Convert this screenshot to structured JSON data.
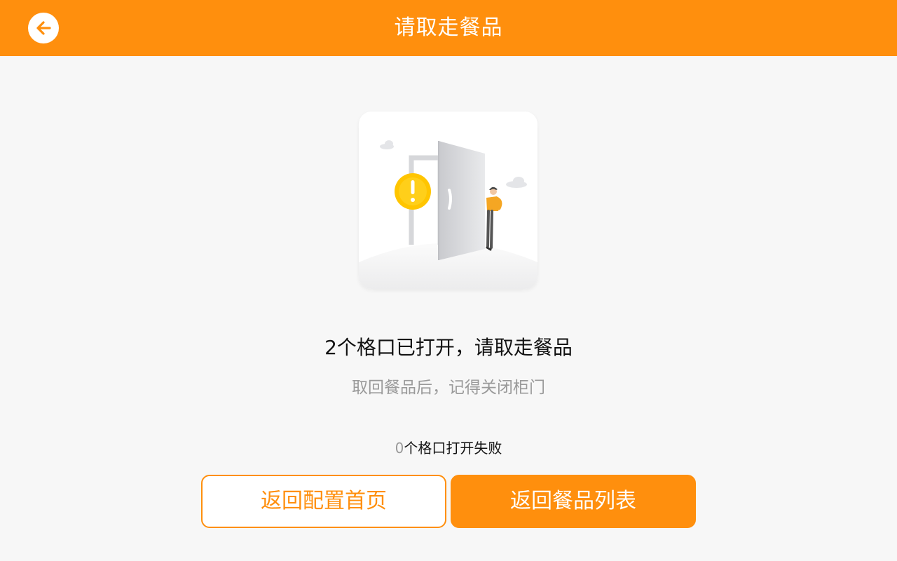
{
  "header": {
    "title": "请取走餐品",
    "back_icon": "arrow-left-icon"
  },
  "illustration": {
    "icon": "open-door-warning-illustration",
    "colors": {
      "warning": "#ffc500",
      "person_shirt": "#f5a623"
    }
  },
  "status": {
    "main_message": "2个格口已打开，请取走餐品",
    "sub_message": "取回餐品后，记得关闭柜门",
    "fail_count": "0",
    "fail_text": "个格口打开失败"
  },
  "actions": {
    "back_to_config_home": "返回配置首页",
    "back_to_food_list": "返回餐品列表"
  },
  "colors": {
    "accent": "#ff8f0d",
    "background": "#f7f7f7",
    "muted_text": "#9a9a9a"
  }
}
